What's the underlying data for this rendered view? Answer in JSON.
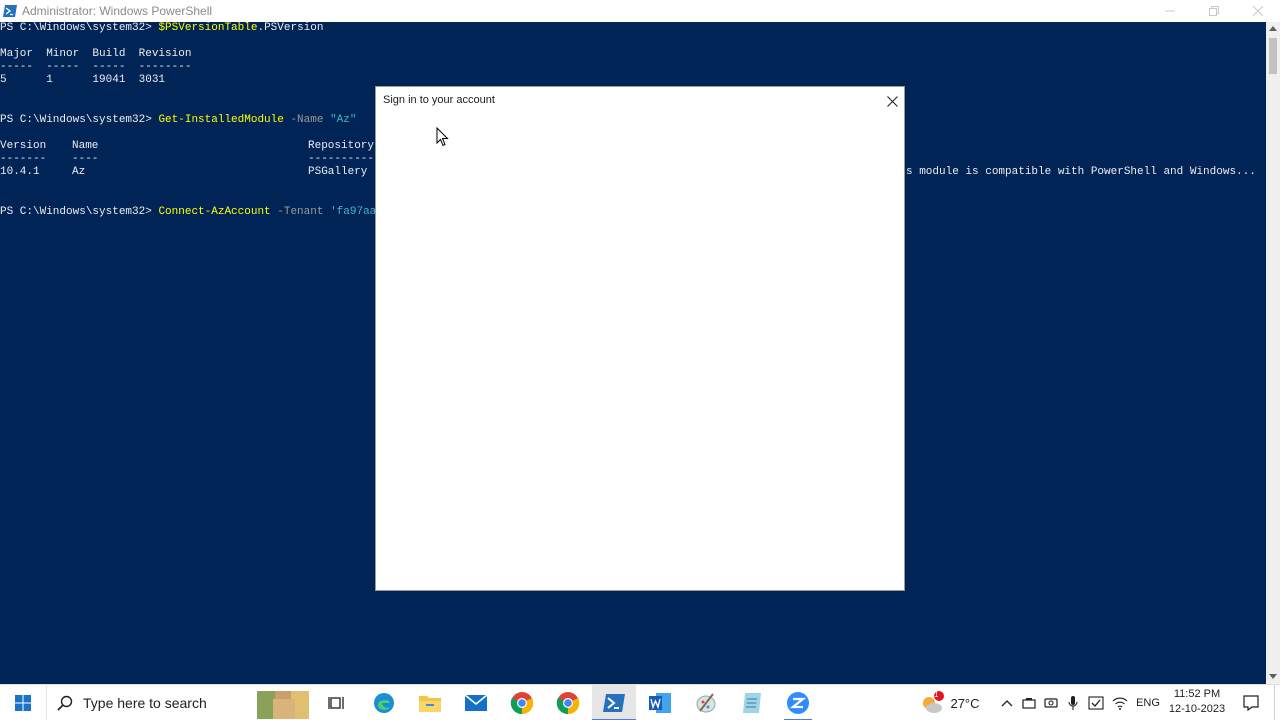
{
  "window": {
    "title": "Administrator: Windows PowerShell"
  },
  "console": {
    "cmd1": {
      "prompt": "PS C:\\Windows\\system32> ",
      "command": "$PSVersionTable",
      "suffix": ".PSVersion"
    },
    "table1": {
      "header": "Major  Minor  Build  Revision",
      "separator": "-----  -----  -----  --------",
      "row": "5      1      19041  3031"
    },
    "cmd2": {
      "prompt": "PS C:\\Windows\\system32> ",
      "command": "Get-InstalledModule",
      "param": " -Name ",
      "value": "\"Az\""
    },
    "table2": {
      "col_version": "Version",
      "col_name": "Name",
      "col_repository": "Repository",
      "sep_version": "-------",
      "sep_name": "----",
      "sep_repository": "----------",
      "row_version": "10.4.1",
      "row_name": "Az",
      "row_repository": "PSGallery",
      "row_description_tail": "s module is compatible with PowerShell and Windows..."
    },
    "cmd3": {
      "prompt": "PS C:\\Windows\\system32> ",
      "command": "Connect-AzAccount",
      "param": " -Tenant ",
      "value": "'fa97aa"
    }
  },
  "dialog": {
    "title": "Sign in to your account"
  },
  "taskbar": {
    "search_placeholder": "Type here to search",
    "weather_temp": "27°C",
    "weather_badge": "1",
    "language": "ENG",
    "time": "11:52 PM",
    "date": "12-10-2023",
    "apps": [
      "task-view",
      "edge",
      "file-explorer",
      "mail",
      "chrome",
      "chrome-profile",
      "powershell",
      "word",
      "paint-tool",
      "notepad",
      "zoom"
    ]
  },
  "colors": {
    "console_bg": "#012456",
    "command_yellow": "#ffff00",
    "string_cyan": "#41b6c4",
    "param_gray": "#9a9a9a"
  }
}
